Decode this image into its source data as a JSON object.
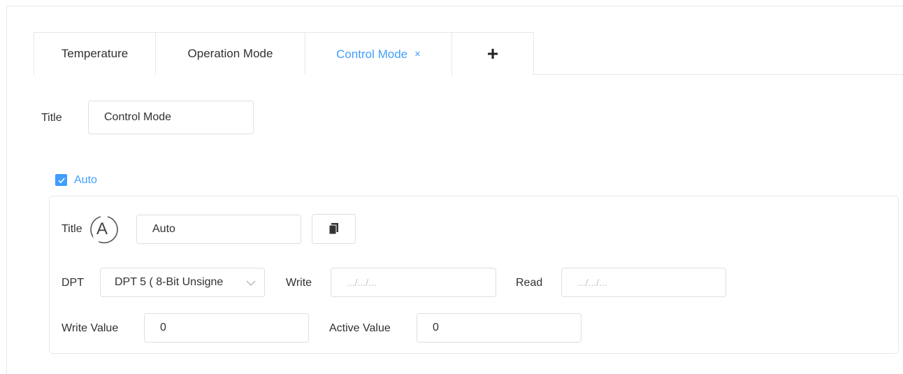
{
  "tabs": [
    {
      "label": "Temperature"
    },
    {
      "label": "Operation Mode"
    },
    {
      "label": "Control Mode",
      "close": "×",
      "active": true
    }
  ],
  "add_tab_label": "+",
  "title_label": "Title",
  "title_value": "Control Mode",
  "auto_checkbox": {
    "label": "Auto",
    "checked": true
  },
  "card": {
    "title_label": "Title",
    "avatar_letter": "A",
    "title_value": "Auto",
    "copy_icon": "copy-icon",
    "dpt_label": "DPT",
    "dpt_value": "DPT 5 ( 8-Bit Unsigne",
    "write_label": "Write",
    "write_placeholder": ".../.../...",
    "read_label": "Read",
    "read_placeholder": ".../.../...",
    "write_value_label": "Write Value",
    "write_value": "0",
    "active_value_label": "Active Value",
    "active_value": "0"
  },
  "colors": {
    "accent": "#409eff",
    "border": "#dcdfe6",
    "text": "#303133"
  }
}
